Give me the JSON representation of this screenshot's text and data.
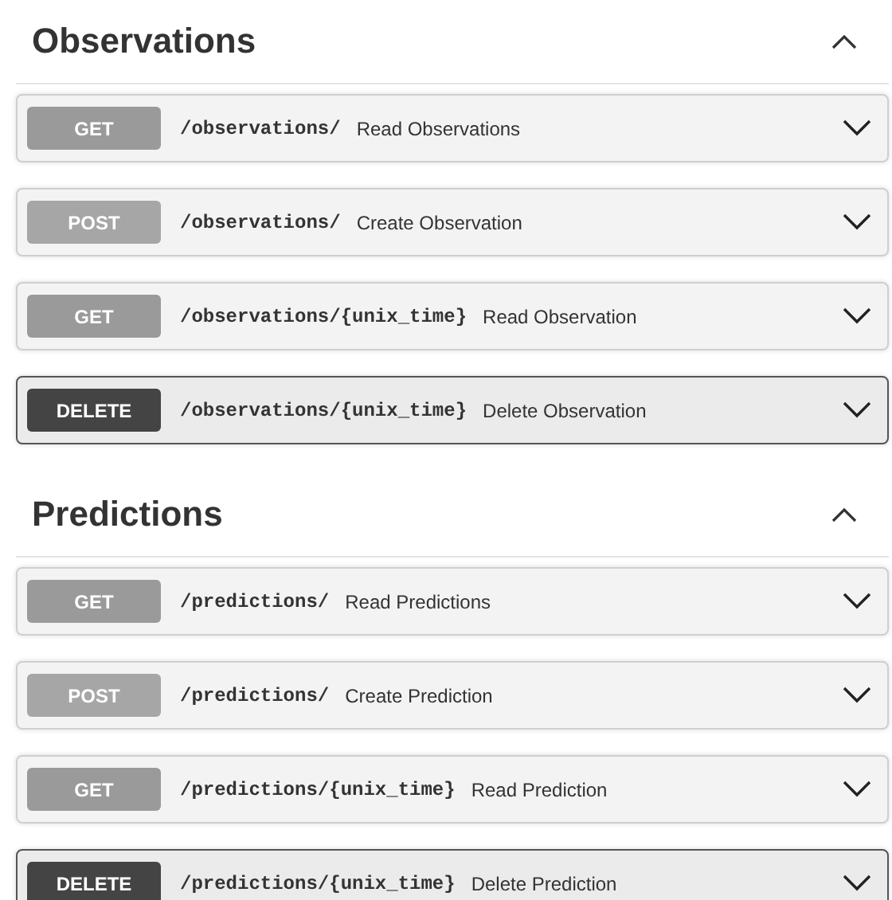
{
  "sections": [
    {
      "title": "Observations",
      "expanded": true,
      "operations": [
        {
          "method": "GET",
          "path": "/observations/",
          "summary": "Read Observations",
          "expanded": false
        },
        {
          "method": "POST",
          "path": "/observations/",
          "summary": "Create Observation",
          "expanded": false
        },
        {
          "method": "GET",
          "path": "/observations/{unix_time}",
          "summary": "Read Observation",
          "expanded": false
        },
        {
          "method": "DELETE",
          "path": "/observations/{unix_time}",
          "summary": "Delete Observation",
          "expanded": false
        }
      ]
    },
    {
      "title": "Predictions",
      "expanded": true,
      "operations": [
        {
          "method": "GET",
          "path": "/predictions/",
          "summary": "Read Predictions",
          "expanded": false
        },
        {
          "method": "POST",
          "path": "/predictions/",
          "summary": "Create Prediction",
          "expanded": false
        },
        {
          "method": "GET",
          "path": "/predictions/{unix_time}",
          "summary": "Read Prediction",
          "expanded": false
        },
        {
          "method": "DELETE",
          "path": "/predictions/{unix_time}",
          "summary": "Delete Prediction",
          "expanded": false
        }
      ]
    }
  ]
}
